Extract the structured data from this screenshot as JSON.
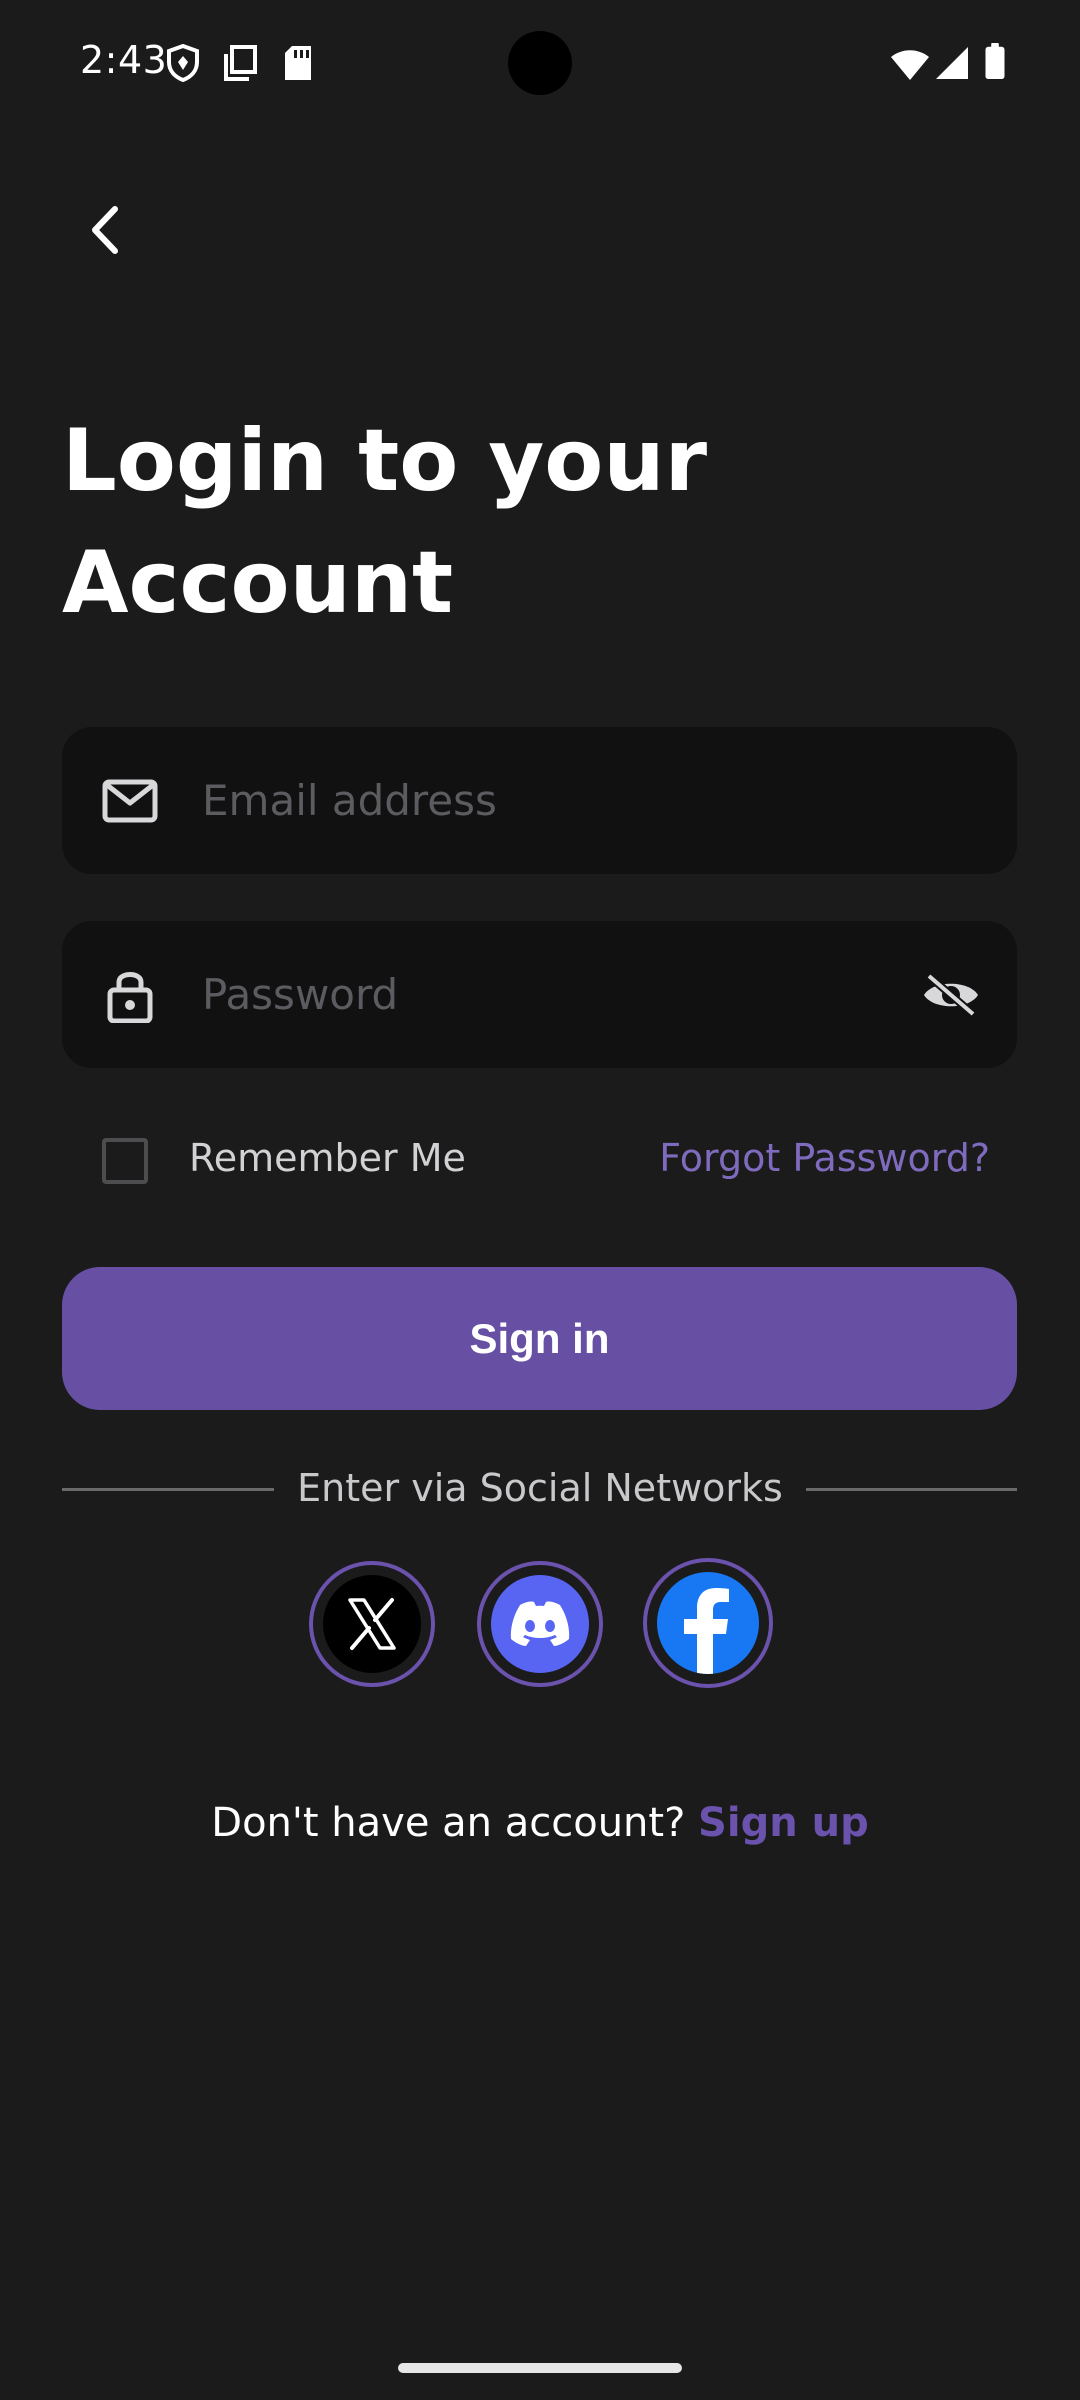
{
  "status_bar": {
    "time": "2:43",
    "left_icons": [
      "shield-icon",
      "copy-icon",
      "sd-card-icon"
    ],
    "right_icons": [
      "wifi-icon",
      "cell-signal-icon",
      "battery-icon"
    ]
  },
  "nav": {
    "back_icon": "chevron-left-icon"
  },
  "header": {
    "title_line1": "Login to your",
    "title_line2": "Account"
  },
  "form": {
    "email_placeholder": "Email address",
    "email_icon": "mail-icon",
    "password_placeholder": "Password",
    "password_icon": "lock-icon",
    "password_toggle_icon": "eye-off-icon",
    "remember_label": "Remember Me",
    "remember_checked": false,
    "forgot_label": "Forgot Password?",
    "signin_label": "Sign in"
  },
  "social": {
    "divider_text": "Enter via Social Networks",
    "providers": [
      "x-icon",
      "discord-icon",
      "facebook-icon"
    ]
  },
  "footer": {
    "signup_prompt": "Don't have an account?",
    "signup_link": "Sign up"
  },
  "colors": {
    "background": "#1b1b1c",
    "field_bg": "#111112",
    "accent": "#6750a4",
    "link": "#7f6bbd"
  }
}
